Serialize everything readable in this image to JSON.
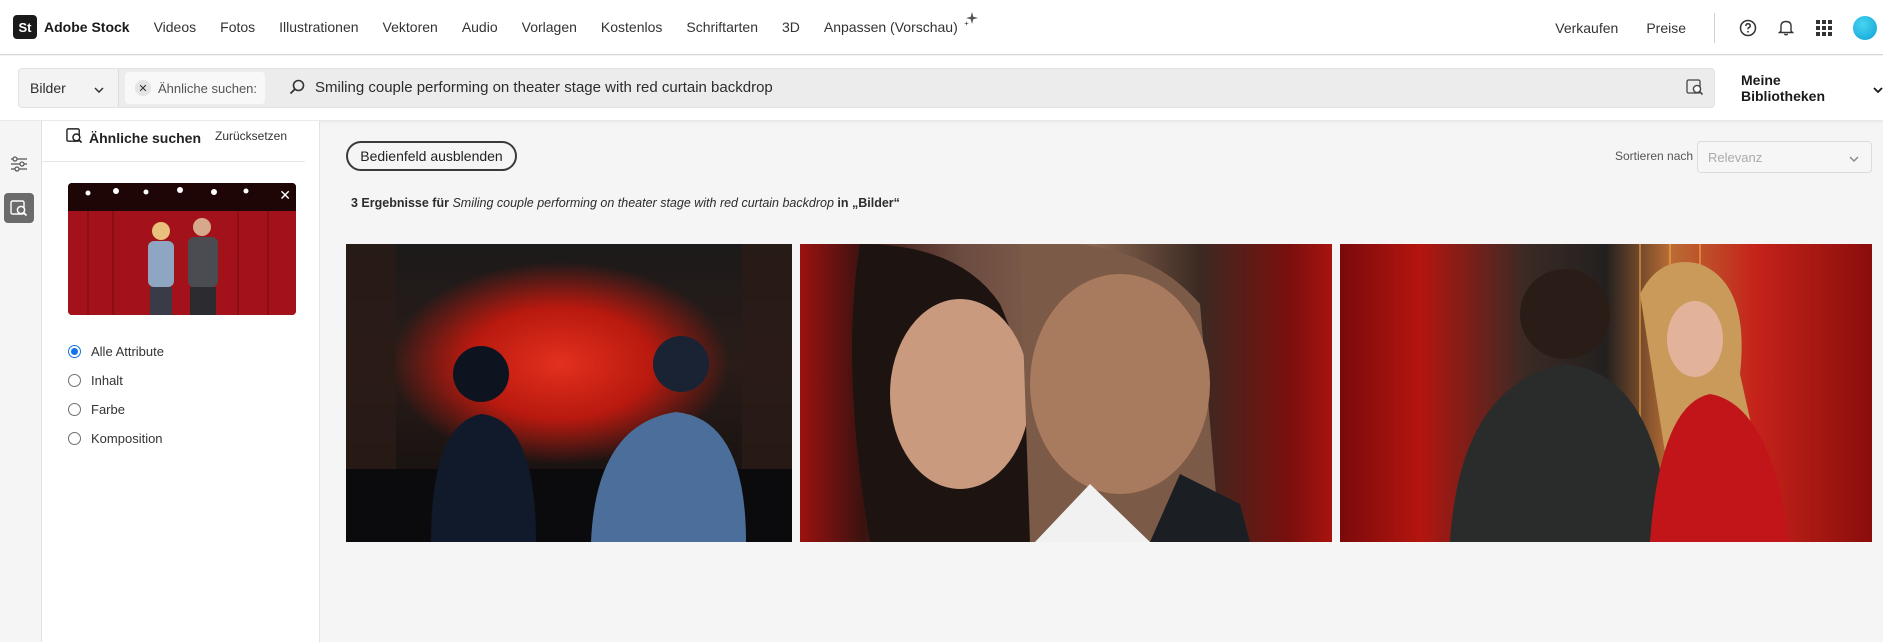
{
  "brand": {
    "logo_mark": "St",
    "name": "Adobe Stock"
  },
  "nav": {
    "items": [
      "Videos",
      "Fotos",
      "Illustrationen",
      "Vektoren",
      "Audio",
      "Vorlagen",
      "Kostenlos",
      "Schriftarten",
      "3D",
      "Anpassen (Vorschau)"
    ],
    "sell": "Verkaufen",
    "pricing": "Preise",
    "icons": [
      "help-icon",
      "bell-icon",
      "apps-grid-icon",
      "avatar"
    ]
  },
  "search": {
    "type_select": "Bilder",
    "similar_chip": "Ähnliche suchen:",
    "query": "Smiling couple performing on theater stage with red curtain backdrop",
    "libraries": "Meine Bibliotheken"
  },
  "panel": {
    "title": "Ähnliche suchen",
    "reset": "Zurücksetzen",
    "options": [
      {
        "label": "Alle Attribute",
        "checked": true
      },
      {
        "label": "Inhalt",
        "checked": false
      },
      {
        "label": "Farbe",
        "checked": false
      },
      {
        "label": "Komposition",
        "checked": false
      }
    ]
  },
  "main": {
    "toggle_panel": "Bedienfeld ausblenden",
    "sort_label": "Sortieren nach",
    "sort_value": "Relevanz",
    "results_count": "3 Ergebnisse für",
    "results_query": "Smiling couple performing on theater stage with red curtain backdrop",
    "results_in": "in „Bilder“"
  },
  "colors": {
    "accent": "#1473e6",
    "curtain_red": "#b8190f"
  }
}
